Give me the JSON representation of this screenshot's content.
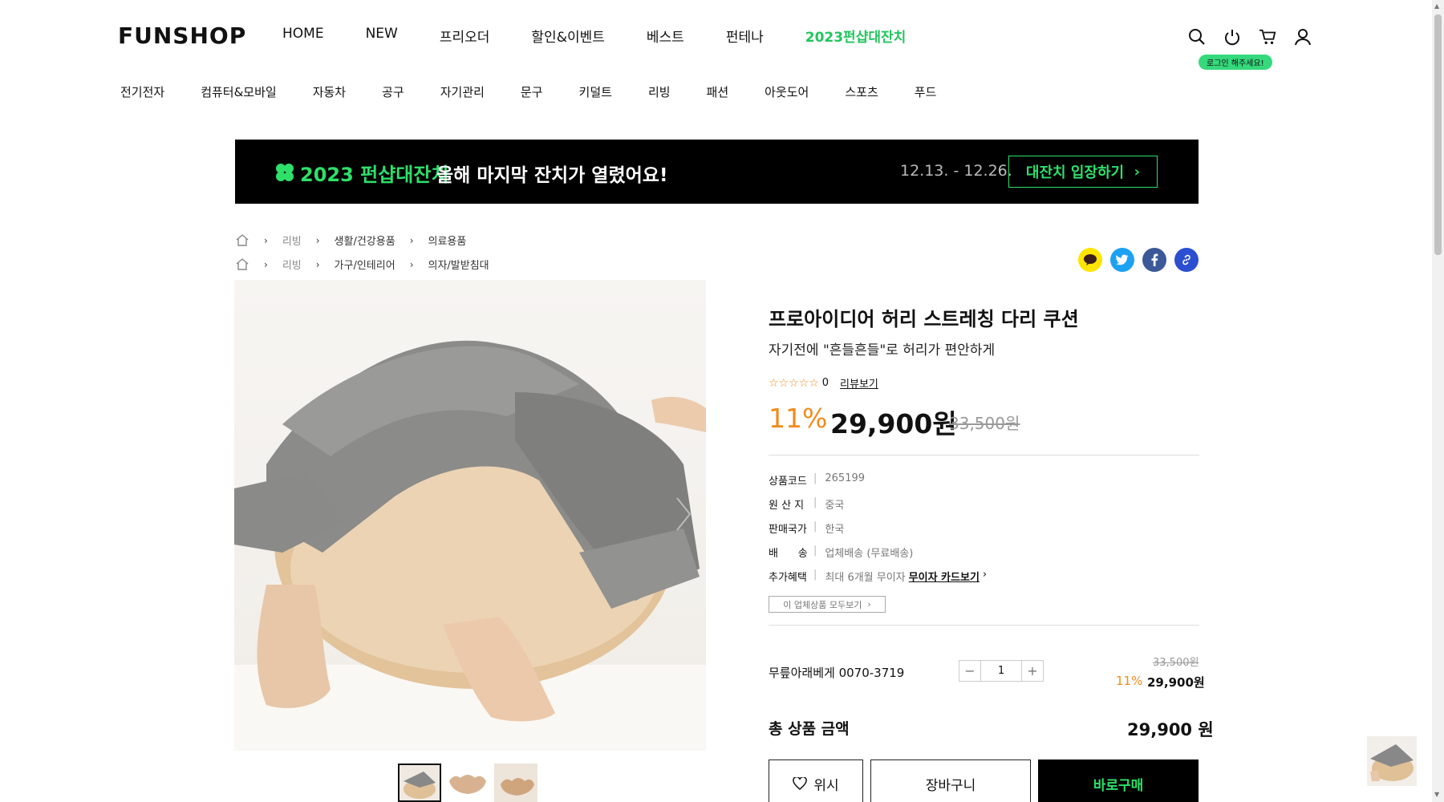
{
  "header": {
    "logo": "FUNSHOP",
    "nav": [
      "HOME",
      "NEW",
      "프리오더",
      "할인&이벤트",
      "베스트",
      "펀테나",
      "2023펀샵대잔치"
    ],
    "login_badge": "로그인 해주세요!"
  },
  "categories": [
    "전기전자",
    "컴퓨터&모바일",
    "자동차",
    "공구",
    "자기관리",
    "문구",
    "키덜트",
    "리빙",
    "패션",
    "아웃도어",
    "스포츠",
    "푸드"
  ],
  "banner": {
    "title": "2023 펀샵대잔치",
    "subtitle": "올해 마지막 잔치가 열렸어요!",
    "dates": "12.13. - 12.26.",
    "cta": "대잔치 입장하기",
    "accent_color": "#2ee06a"
  },
  "breadcrumbs": [
    [
      "리빙",
      "생활/건강용품",
      "의료용품"
    ],
    [
      "리빙",
      "가구/인테리어",
      "의자/발받침대"
    ]
  ],
  "product": {
    "title": "프로아이디어 허리 스트레칭 다리 쿠션",
    "subtitle": "자기전에 \"흔들흔들\"로 허리가 편안하게",
    "rating_count": "0",
    "rating_value": 0,
    "review_link": "리뷰보기",
    "discount": "11%",
    "price": "29,900원",
    "original_price": "33,500원",
    "specs": [
      {
        "key": "상품코드",
        "value": "265199"
      },
      {
        "key": "원 산 지",
        "value": "중국"
      },
      {
        "key": "판매국가",
        "value": "한국"
      },
      {
        "key": "배      송",
        "value": "업체배송 (무료배송)"
      },
      {
        "key": "추가혜택",
        "value": "최대 6개월 무이자",
        "link": "무이자 카드보기"
      }
    ],
    "all_products_btn": "이 업체상품 모두보기"
  },
  "option": {
    "name": "무릎아래베게 0070-3719",
    "quantity": "1",
    "original_price": "33,500원",
    "discount": "11%",
    "price": "29,900원"
  },
  "total": {
    "label": "총 상품 금액",
    "value": "29,900 원"
  },
  "buttons": {
    "wish": "위시",
    "cart": "장바구니",
    "buy": "바로구매"
  }
}
